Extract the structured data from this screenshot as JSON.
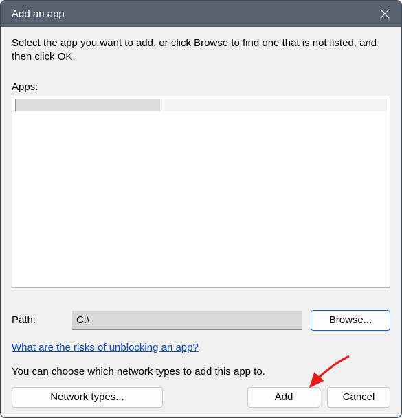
{
  "titlebar": {
    "title": "Add an app"
  },
  "instruction": "Select the app you want to add, or click Browse to find one that is not listed, and then click OK.",
  "apps_label": "Apps:",
  "path": {
    "label": "Path:",
    "value": "C:\\",
    "browse_label": "Browse..."
  },
  "risk_link": "What are the risks of unblocking an app?",
  "network_text": "You can choose which network types to add this app to.",
  "buttons": {
    "network_types": "Network types...",
    "add": "Add",
    "cancel": "Cancel"
  }
}
